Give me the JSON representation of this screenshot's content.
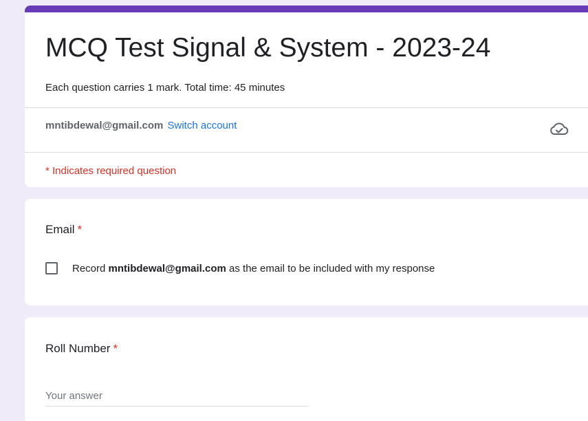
{
  "form": {
    "title": "MCQ Test Signal & System - 2023-24",
    "description": "Each question carries 1 mark. Total time: 45 minutes",
    "accent_color": "#673ab7"
  },
  "account": {
    "email": "mntibdewal@gmail.com",
    "switch_label": "Switch account",
    "cloud_icon": "cloud-check-icon"
  },
  "required_note": "* Indicates required question",
  "questions": [
    {
      "title": "Email",
      "required_mark": "*",
      "checkbox": {
        "checked": false,
        "label_prefix": "Record",
        "label_email": "mntibdewal@gmail.com",
        "label_suffix": "as the email to be included with my response"
      }
    },
    {
      "title": "Roll Number",
      "required_mark": "*",
      "answer": {
        "value": "",
        "placeholder": "Your answer"
      }
    }
  ]
}
